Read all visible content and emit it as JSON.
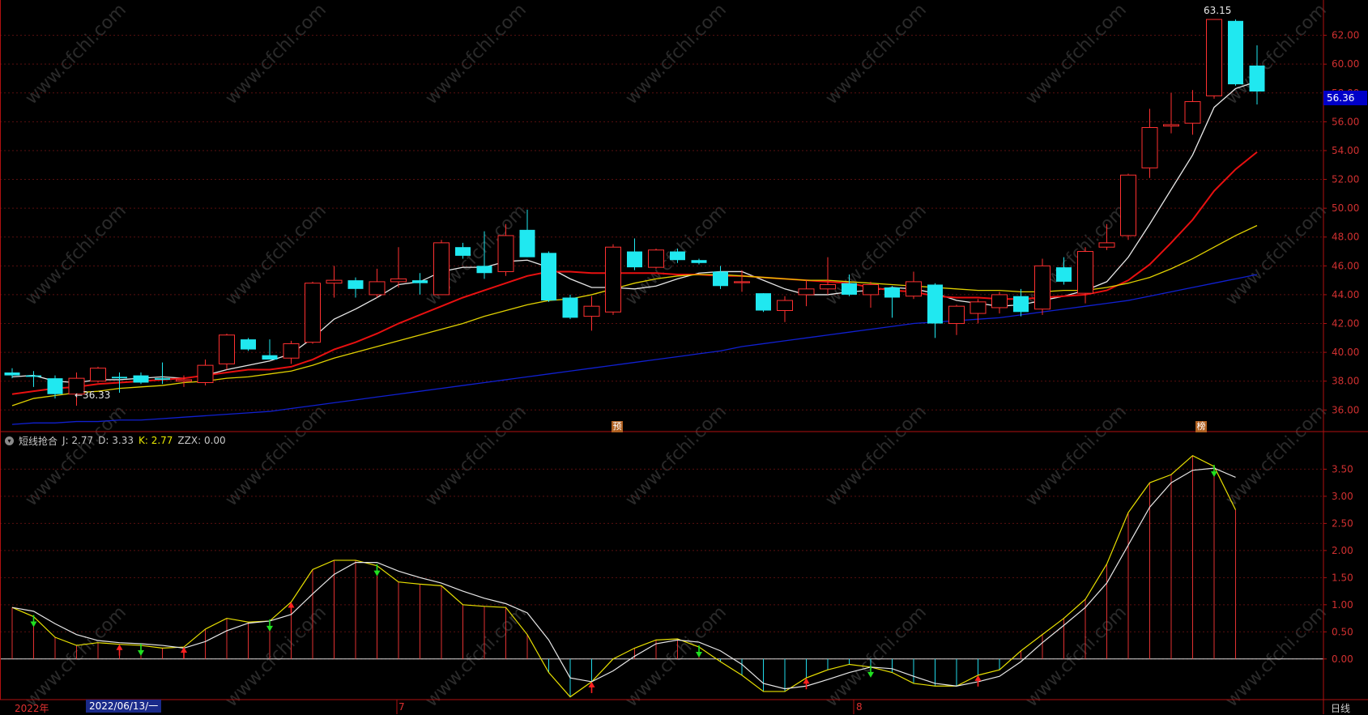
{
  "chart_data": [
    {
      "type": "candlestick",
      "title": "",
      "ylim": [
        34.5,
        64.0
      ],
      "y_ticks": [
        "36.00",
        "38.00",
        "40.00",
        "42.00",
        "44.00",
        "46.00",
        "48.00",
        "50.00",
        "52.00",
        "54.00",
        "56.00",
        "58.00",
        "60.00",
        "62.00"
      ],
      "last_price": "56.36",
      "low_label": "←36.33",
      "high_label": "63.15",
      "markers": [
        "预",
        "榜"
      ],
      "candles": [
        {
          "o": 38.6,
          "h": 38.9,
          "l": 38.2,
          "c": 38.4
        },
        {
          "o": 38.4,
          "h": 38.7,
          "l": 37.6,
          "c": 38.3
        },
        {
          "o": 38.2,
          "h": 38.4,
          "l": 36.8,
          "c": 37.1
        },
        {
          "o": 37.1,
          "h": 38.6,
          "l": 36.3,
          "c": 38.2
        },
        {
          "o": 38.0,
          "h": 39.0,
          "l": 37.9,
          "c": 38.9
        },
        {
          "o": 38.3,
          "h": 38.6,
          "l": 37.2,
          "c": 38.2
        },
        {
          "o": 38.4,
          "h": 38.6,
          "l": 37.8,
          "c": 37.9
        },
        {
          "o": 38.2,
          "h": 39.3,
          "l": 37.8,
          "c": 38.1
        },
        {
          "o": 38.0,
          "h": 38.4,
          "l": 37.6,
          "c": 38.1
        },
        {
          "o": 37.9,
          "h": 39.5,
          "l": 37.7,
          "c": 39.1
        },
        {
          "o": 39.2,
          "h": 41.3,
          "l": 38.8,
          "c": 41.2
        },
        {
          "o": 40.9,
          "h": 41.0,
          "l": 40.1,
          "c": 40.2
        },
        {
          "o": 39.8,
          "h": 40.9,
          "l": 39.6,
          "c": 39.5
        },
        {
          "o": 39.6,
          "h": 40.8,
          "l": 39.2,
          "c": 40.6
        },
        {
          "o": 40.7,
          "h": 44.9,
          "l": 40.6,
          "c": 44.8
        },
        {
          "o": 44.8,
          "h": 46.0,
          "l": 43.8,
          "c": 45.0
        },
        {
          "o": 45.0,
          "h": 45.2,
          "l": 43.8,
          "c": 44.4
        },
        {
          "o": 44.0,
          "h": 45.8,
          "l": 43.8,
          "c": 44.9
        },
        {
          "o": 44.9,
          "h": 47.3,
          "l": 44.5,
          "c": 45.1
        },
        {
          "o": 45.0,
          "h": 45.5,
          "l": 44.0,
          "c": 44.8
        },
        {
          "o": 44.0,
          "h": 47.8,
          "l": 44.0,
          "c": 47.6
        },
        {
          "o": 47.3,
          "h": 47.6,
          "l": 46.5,
          "c": 46.7
        },
        {
          "o": 46.0,
          "h": 48.4,
          "l": 45.1,
          "c": 45.5
        },
        {
          "o": 45.6,
          "h": 48.9,
          "l": 45.3,
          "c": 48.1
        },
        {
          "o": 48.5,
          "h": 49.9,
          "l": 46.6,
          "c": 46.6
        },
        {
          "o": 46.9,
          "h": 47.0,
          "l": 43.5,
          "c": 43.6
        },
        {
          "o": 43.8,
          "h": 44.0,
          "l": 42.3,
          "c": 42.4
        },
        {
          "o": 42.5,
          "h": 43.9,
          "l": 41.5,
          "c": 43.2
        },
        {
          "o": 42.8,
          "h": 47.5,
          "l": 42.6,
          "c": 47.3
        },
        {
          "o": 47.0,
          "h": 47.9,
          "l": 45.7,
          "c": 45.9
        },
        {
          "o": 45.9,
          "h": 47.2,
          "l": 45.8,
          "c": 47.1
        },
        {
          "o": 47.0,
          "h": 47.2,
          "l": 46.2,
          "c": 46.4
        },
        {
          "o": 46.4,
          "h": 46.5,
          "l": 46.1,
          "c": 46.2
        },
        {
          "o": 45.6,
          "h": 46.0,
          "l": 44.4,
          "c": 44.6
        },
        {
          "o": 44.9,
          "h": 45.7,
          "l": 44.2,
          "c": 44.9
        },
        {
          "o": 44.1,
          "h": 44.1,
          "l": 42.8,
          "c": 42.9
        },
        {
          "o": 42.9,
          "h": 43.9,
          "l": 42.1,
          "c": 43.6
        },
        {
          "o": 44.0,
          "h": 45.0,
          "l": 43.2,
          "c": 44.4
        },
        {
          "o": 44.4,
          "h": 46.6,
          "l": 44.0,
          "c": 44.7
        },
        {
          "o": 44.8,
          "h": 45.4,
          "l": 43.9,
          "c": 44.0
        },
        {
          "o": 44.0,
          "h": 44.9,
          "l": 43.1,
          "c": 44.7
        },
        {
          "o": 44.5,
          "h": 44.6,
          "l": 42.4,
          "c": 43.8
        },
        {
          "o": 43.9,
          "h": 45.6,
          "l": 43.7,
          "c": 44.9
        },
        {
          "o": 44.7,
          "h": 44.8,
          "l": 41.0,
          "c": 42.0
        },
        {
          "o": 42.0,
          "h": 43.3,
          "l": 41.2,
          "c": 43.2
        },
        {
          "o": 42.7,
          "h": 43.7,
          "l": 42.0,
          "c": 43.5
        },
        {
          "o": 43.1,
          "h": 44.2,
          "l": 42.7,
          "c": 44.0
        },
        {
          "o": 43.9,
          "h": 44.4,
          "l": 42.5,
          "c": 42.8
        },
        {
          "o": 43.0,
          "h": 46.5,
          "l": 42.6,
          "c": 46.0
        },
        {
          "o": 45.9,
          "h": 46.6,
          "l": 44.7,
          "c": 44.9
        },
        {
          "o": 44.1,
          "h": 47.3,
          "l": 43.4,
          "c": 47.0
        },
        {
          "o": 47.3,
          "h": 48.9,
          "l": 47.1,
          "c": 47.6
        },
        {
          "o": 48.1,
          "h": 52.4,
          "l": 47.8,
          "c": 52.3
        },
        {
          "o": 52.8,
          "h": 56.9,
          "l": 52.1,
          "c": 55.6
        },
        {
          "o": 55.7,
          "h": 58.0,
          "l": 55.2,
          "c": 55.8
        },
        {
          "o": 55.9,
          "h": 58.2,
          "l": 55.1,
          "c": 57.4
        },
        {
          "o": 57.8,
          "h": 63.1,
          "l": 57.6,
          "c": 63.1
        },
        {
          "o": 63.0,
          "h": 63.1,
          "l": 58.5,
          "c": 58.6
        },
        {
          "o": 59.9,
          "h": 61.3,
          "l": 57.2,
          "c": 58.1
        }
      ],
      "ma_series": [
        {
          "color": "#e8e8e8",
          "values": [
            38.3,
            38.4,
            38.0,
            37.9,
            38.1,
            38.1,
            38.2,
            38.3,
            38.2,
            38.4,
            38.8,
            39.1,
            39.4,
            39.9,
            41.0,
            42.3,
            43.0,
            43.8,
            44.7,
            44.9,
            45.6,
            45.9,
            45.9,
            46.3,
            46.4,
            45.9,
            45.1,
            44.5,
            44.5,
            44.4,
            44.6,
            45.1,
            45.5,
            45.6,
            45.6,
            45.0,
            44.4,
            44.0,
            44.0,
            44.2,
            44.3,
            44.5,
            44.4,
            44.1,
            43.6,
            43.4,
            43.2,
            43.3,
            43.6,
            43.9,
            44.3,
            44.9,
            46.6,
            48.9,
            51.3,
            53.7,
            57.0,
            58.3,
            58.8
          ]
        },
        {
          "color": "#e81010",
          "values": [
            37.1,
            37.3,
            37.5,
            37.6,
            37.8,
            37.9,
            38.0,
            38.1,
            38.2,
            38.4,
            38.6,
            38.8,
            38.8,
            39.0,
            39.5,
            40.2,
            40.7,
            41.3,
            42.0,
            42.6,
            43.2,
            43.8,
            44.3,
            44.8,
            45.3,
            45.6,
            45.6,
            45.5,
            45.5,
            45.5,
            45.5,
            45.4,
            45.4,
            45.3,
            45.3,
            45.2,
            45.1,
            45.0,
            44.9,
            44.8,
            44.5,
            44.3,
            44.2,
            43.9,
            43.8,
            43.8,
            43.7,
            43.7,
            43.8,
            43.9,
            44.0,
            44.3,
            45.0,
            46.1,
            47.6,
            49.2,
            51.2,
            52.7,
            53.9
          ]
        },
        {
          "color": "#e0d000",
          "values": [
            36.3,
            36.8,
            37.0,
            37.2,
            37.3,
            37.5,
            37.6,
            37.7,
            37.9,
            38.0,
            38.2,
            38.3,
            38.5,
            38.7,
            39.1,
            39.6,
            40.0,
            40.4,
            40.8,
            41.2,
            41.6,
            42.0,
            42.5,
            42.9,
            43.3,
            43.6,
            43.7,
            44.0,
            44.4,
            44.8,
            45.1,
            45.3,
            45.4,
            45.4,
            45.3,
            45.2,
            45.1,
            45.0,
            45.0,
            44.9,
            44.8,
            44.7,
            44.6,
            44.5,
            44.4,
            44.3,
            44.3,
            44.2,
            44.2,
            44.3,
            44.3,
            44.5,
            44.8,
            45.2,
            45.8,
            46.5,
            47.3,
            48.1,
            48.8
          ]
        },
        {
          "color": "#1020d0",
          "values": [
            35.0,
            35.1,
            35.1,
            35.2,
            35.2,
            35.3,
            35.3,
            35.4,
            35.5,
            35.6,
            35.7,
            35.8,
            35.9,
            36.1,
            36.3,
            36.5,
            36.7,
            36.9,
            37.1,
            37.3,
            37.5,
            37.7,
            37.9,
            38.1,
            38.3,
            38.5,
            38.7,
            38.9,
            39.1,
            39.3,
            39.5,
            39.7,
            39.9,
            40.1,
            40.4,
            40.6,
            40.8,
            41.0,
            41.2,
            41.4,
            41.6,
            41.8,
            42.0,
            42.1,
            42.2,
            42.3,
            42.4,
            42.6,
            42.8,
            43.0,
            43.2,
            43.4,
            43.6,
            43.9,
            44.2,
            44.5,
            44.8,
            45.1,
            45.4
          ]
        }
      ]
    },
    {
      "type": "bar+line",
      "indicator_name": "短线抢合",
      "labels": {
        "j": "J: 2.77",
        "d": "D: 3.33",
        "k": "K: 2.77",
        "zzx": "ZZX: 0.00"
      },
      "ylim": [
        -0.75,
        3.85
      ],
      "y_ticks": [
        "0.00",
        "0.50",
        "1.00",
        "1.50",
        "2.00",
        "2.50",
        "3.00",
        "3.50"
      ],
      "j_values": [
        0.95,
        0.78,
        0.4,
        0.25,
        0.3,
        0.27,
        0.25,
        0.2,
        0.22,
        0.55,
        0.75,
        0.68,
        0.7,
        1.05,
        1.65,
        1.82,
        1.82,
        1.72,
        1.42,
        1.38,
        1.35,
        1.0,
        0.97,
        0.95,
        0.45,
        -0.25,
        -0.7,
        -0.42,
        0.0,
        0.2,
        0.35,
        0.37,
        0.22,
        -0.05,
        -0.3,
        -0.6,
        -0.6,
        -0.35,
        -0.2,
        -0.1,
        -0.15,
        -0.25,
        -0.45,
        -0.5,
        -0.5,
        -0.3,
        -0.2,
        0.15,
        0.45,
        0.75,
        1.1,
        1.75,
        2.7,
        3.25,
        3.4,
        3.75,
        3.55,
        2.75
      ],
      "d_values": [
        0.95,
        0.88,
        0.65,
        0.45,
        0.34,
        0.3,
        0.28,
        0.25,
        0.2,
        0.32,
        0.52,
        0.66,
        0.7,
        0.82,
        1.2,
        1.56,
        1.78,
        1.78,
        1.62,
        1.5,
        1.4,
        1.25,
        1.12,
        1.02,
        0.85,
        0.35,
        -0.35,
        -0.42,
        -0.22,
        0.05,
        0.28,
        0.35,
        0.31,
        0.15,
        -0.1,
        -0.45,
        -0.55,
        -0.5,
        -0.38,
        -0.25,
        -0.15,
        -0.18,
        -0.32,
        -0.45,
        -0.5,
        -0.42,
        -0.32,
        -0.05,
        0.3,
        0.62,
        0.95,
        1.4,
        2.1,
        2.8,
        3.25,
        3.48,
        3.52,
        3.35
      ],
      "signals": [
        {
          "i": 1,
          "dir": "down"
        },
        {
          "i": 5,
          "dir": "up"
        },
        {
          "i": 6,
          "dir": "down"
        },
        {
          "i": 8,
          "dir": "up"
        },
        {
          "i": 12,
          "dir": "down"
        },
        {
          "i": 13,
          "dir": "up"
        },
        {
          "i": 17,
          "dir": "down"
        },
        {
          "i": 27,
          "dir": "up"
        },
        {
          "i": 32,
          "dir": "down"
        },
        {
          "i": 37,
          "dir": "up"
        },
        {
          "i": 40,
          "dir": "down"
        },
        {
          "i": 45,
          "dir": "up"
        },
        {
          "i": 56,
          "dir": "down"
        }
      ]
    }
  ],
  "x_axis": {
    "year_label": "2022年",
    "cursor_date": "2022/06/13/一",
    "month_7": "7",
    "month_8": "8",
    "period": "日线"
  },
  "watermark": "www.cfchi.com"
}
